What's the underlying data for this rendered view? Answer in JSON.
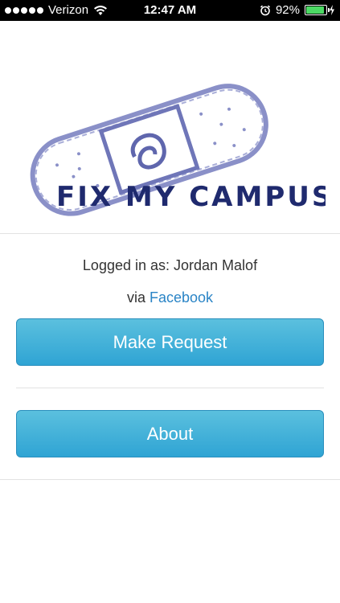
{
  "status_bar": {
    "carrier": "Verizon",
    "time": "12:47 AM",
    "battery_percent": "92%",
    "battery_level": 0.92
  },
  "logo": {
    "text": "FIX MY CAMPUS"
  },
  "session": {
    "logged_in_label": "Logged in as: Jordan Malof",
    "via_prefix": "via",
    "provider_link": "Facebook"
  },
  "buttons": {
    "make_request": "Make Request",
    "about": "About"
  },
  "colors": {
    "button_top": "#5bc0de",
    "button_bottom": "#2fa4d4",
    "link": "#2a84c6",
    "logo_ink": "#1f2a6e",
    "logo_bandage": "#8a90c8",
    "battery_fill": "#4cd964"
  }
}
